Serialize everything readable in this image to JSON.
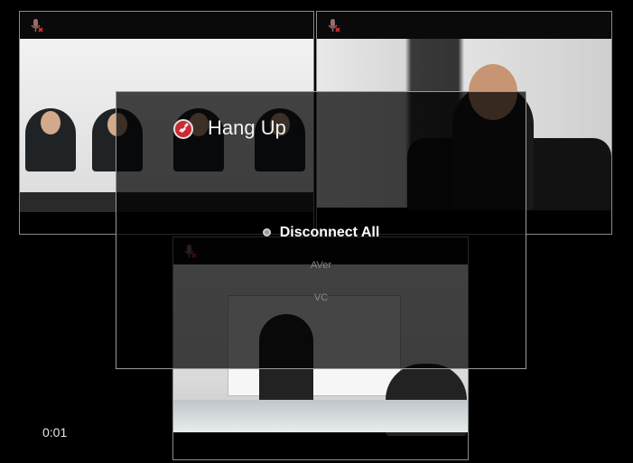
{
  "panes": {
    "pane1": {
      "mic_icon": "mic-muted-icon"
    },
    "pane2": {
      "mic_icon": "mic-muted-icon"
    },
    "pane3": {
      "mic_icon": "mic-muted-icon"
    }
  },
  "call": {
    "elapsed": "0:01"
  },
  "dialog": {
    "title": "Hang Up",
    "icon": "hang-up-icon",
    "options": [
      {
        "label": "Disconnect All",
        "selected": true
      },
      {
        "label": "AVer",
        "selected": false
      },
      {
        "label": "VC",
        "selected": false
      }
    ]
  },
  "colors": {
    "accent": "#c92a33",
    "background": "#000000",
    "border": "#9a9a9a"
  }
}
